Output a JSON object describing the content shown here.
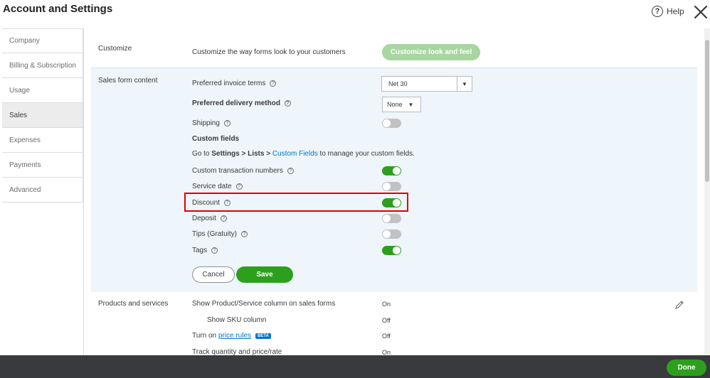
{
  "header": {
    "title": "Account and Settings",
    "help_label": "Help"
  },
  "sidebar": {
    "items": [
      {
        "label": "Company"
      },
      {
        "label": "Billing & Subscription"
      },
      {
        "label": "Usage"
      },
      {
        "label": "Sales",
        "active": true
      },
      {
        "label": "Expenses"
      },
      {
        "label": "Payments"
      },
      {
        "label": "Advanced"
      }
    ]
  },
  "customize": {
    "section_label": "Customize",
    "description": "Customize the way forms look to your customers",
    "button_label": "Customize look and feel"
  },
  "sales_form": {
    "section_label": "Sales form content",
    "preferred_invoice_terms_label": "Preferred invoice terms",
    "preferred_invoice_terms_value": "Net 30",
    "preferred_delivery_label": "Preferred delivery method",
    "preferred_delivery_value": "None",
    "shipping_label": "Shipping",
    "shipping_on": false,
    "custom_fields_heading": "Custom fields",
    "custom_fields_hint": {
      "prefix": "Go to ",
      "settings": "Settings",
      "sep1": " > ",
      "lists": "Lists",
      "sep2": " > ",
      "link": "Custom Fields",
      "suffix": " to manage your custom fields."
    },
    "toggles": [
      {
        "label": "Custom transaction numbers",
        "on": true
      },
      {
        "label": "Service date",
        "on": false
      },
      {
        "label": "Discount",
        "on": true
      },
      {
        "label": "Deposit",
        "on": false
      },
      {
        "label": "Tips (Gratuity)",
        "on": false
      },
      {
        "label": "Tags",
        "on": true
      }
    ],
    "cancel_label": "Cancel",
    "save_label": "Save"
  },
  "products": {
    "section_label": "Products and services",
    "rows": [
      {
        "label": "Show Product/Service column on sales forms",
        "value": "On"
      },
      {
        "label": "Show SKU column",
        "value": "Off"
      },
      {
        "label_prefix": "Turn on ",
        "link": "price rules",
        "badge": "BETA",
        "value": "Off"
      },
      {
        "label": "Track quantity and price/rate",
        "value": "On"
      }
    ]
  },
  "footer": {
    "done_label": "Done"
  },
  "colors": {
    "accent_green": "#2ca01c",
    "link_blue": "#0077c5",
    "highlight_red": "#e00000"
  }
}
